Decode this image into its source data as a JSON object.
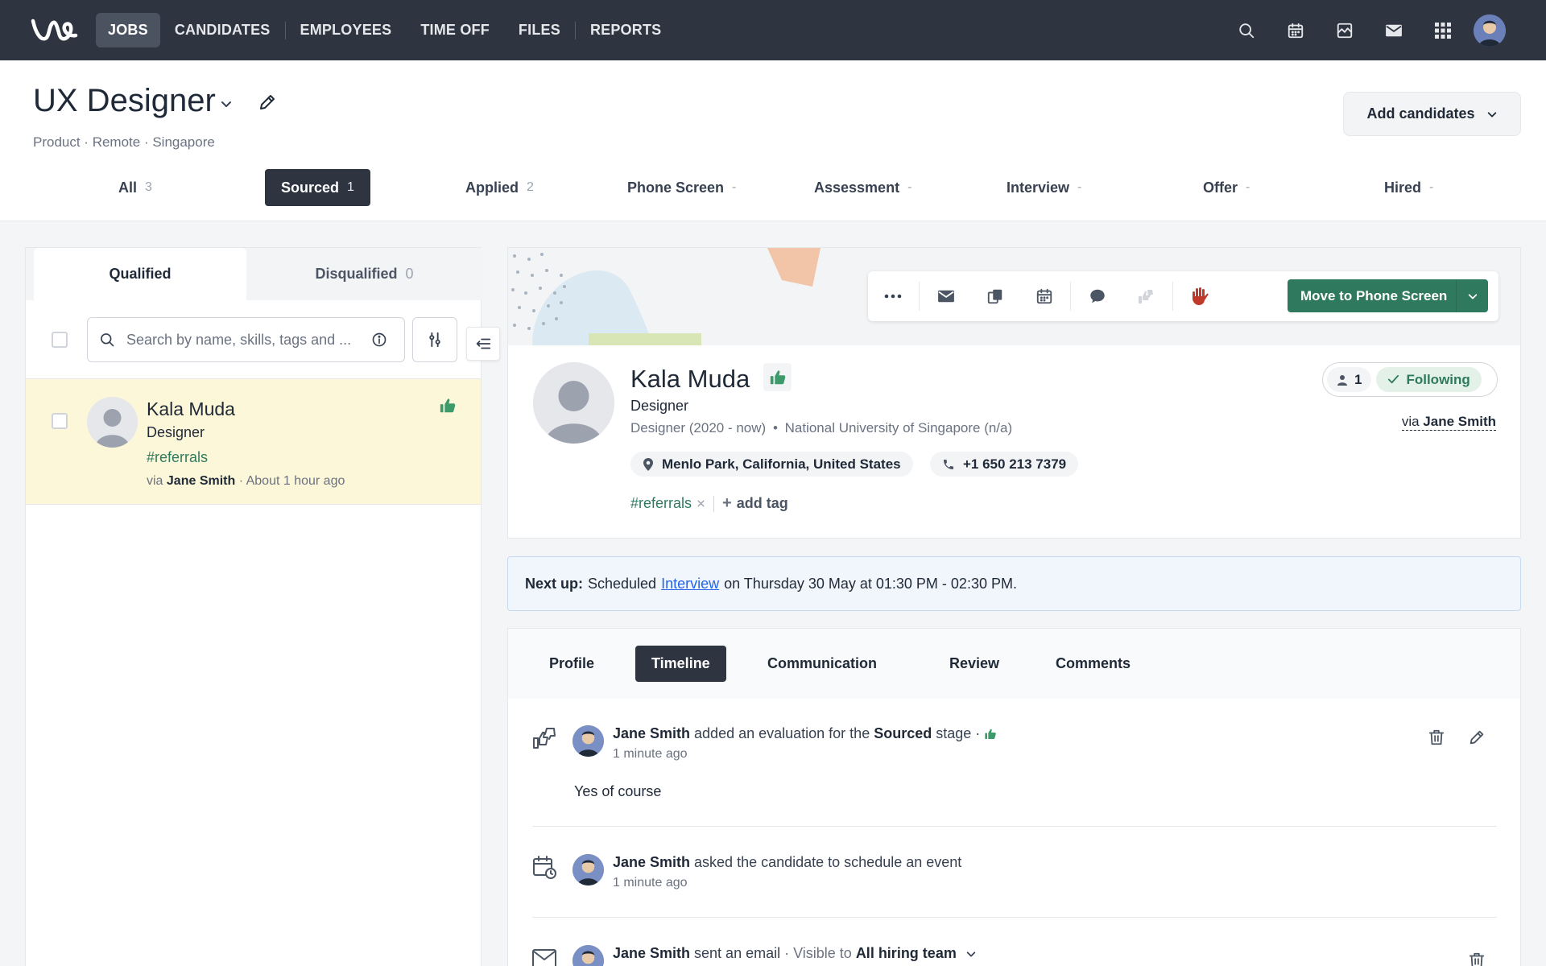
{
  "nav": {
    "items": [
      {
        "label": "JOBS",
        "active": true
      },
      {
        "label": "CANDIDATES"
      },
      {
        "label": "EMPLOYEES"
      },
      {
        "label": "TIME OFF"
      },
      {
        "label": "FILES"
      },
      {
        "label": "REPORTS"
      }
    ],
    "icons": [
      "search-icon",
      "calendar-icon",
      "inbox-icon",
      "mail-icon",
      "apps-grid-icon",
      "user-avatar"
    ]
  },
  "job": {
    "title": "UX Designer",
    "meta": "Product · Remote · Singapore",
    "add_candidates_label": "Add candidates"
  },
  "stages": [
    {
      "label": "All",
      "count": "3"
    },
    {
      "label": "Sourced",
      "count": "1",
      "active": true
    },
    {
      "label": "Applied",
      "count": "2"
    },
    {
      "label": "Phone Screen",
      "count": "-"
    },
    {
      "label": "Assessment",
      "count": "-"
    },
    {
      "label": "Interview",
      "count": "-"
    },
    {
      "label": "Offer",
      "count": "-"
    },
    {
      "label": "Hired",
      "count": "-"
    }
  ],
  "list": {
    "tabs": {
      "qualified": "Qualified",
      "disqualified": "Disqualified",
      "disqualified_count": "0"
    },
    "search_placeholder": "Search by name, skills, tags and ...",
    "candidates": [
      {
        "name": "Kala Muda",
        "title": "Designer",
        "tag": "#referrals",
        "via_prefix": "via",
        "via_name": "Jane Smith",
        "time": "· About 1 hour ago"
      }
    ]
  },
  "profile": {
    "name": "Kala Muda",
    "title": "Designer",
    "history": "Designer (2020 - now)",
    "education": "National University of Singapore (n/a)",
    "location": "Menlo Park, California, United States",
    "phone": "+1 650 213 7379",
    "tag": "#referrals",
    "add_tag_label": "add tag",
    "followers_count": "1",
    "following_label": "Following",
    "via_prefix": "via",
    "via_name": "Jane Smith",
    "move_button_label": "Move to Phone Screen",
    "action_icons": [
      "more-icon",
      "email-icon",
      "copy-icon",
      "calendar-icon",
      "comment-icon",
      "evaluation-icon",
      "disqualify-hand-icon"
    ]
  },
  "next_up": {
    "prefix": "Next up:",
    "text1": "Scheduled",
    "link": "Interview",
    "text2": "on Thursday 30 May at 01:30 PM - 02:30 PM."
  },
  "detail_tabs": [
    {
      "label": "Profile"
    },
    {
      "label": "Timeline",
      "active": true
    },
    {
      "label": "Communication"
    },
    {
      "label": "Review"
    },
    {
      "label": "Comments"
    }
  ],
  "timeline": [
    {
      "actor": "Jane Smith",
      "action": "added an evaluation for the",
      "stage": "Sourced",
      "suffix": "stage ·",
      "time": "1 minute ago",
      "body": "Yes of course"
    },
    {
      "actor": "Jane Smith",
      "action": "asked the candidate to schedule an event",
      "time": "1 minute ago"
    },
    {
      "actor": "Jane Smith",
      "action": "sent an email",
      "visibility_prefix": "· Visible to",
      "visibility": "All hiring team"
    }
  ],
  "colors": {
    "nav_bg": "#2e3440",
    "accent_green": "#2f7a5f",
    "thumbs_green": "#3d9a6b",
    "highlight_row": "#fdf7d9",
    "disqualify_red": "#c0392b"
  }
}
